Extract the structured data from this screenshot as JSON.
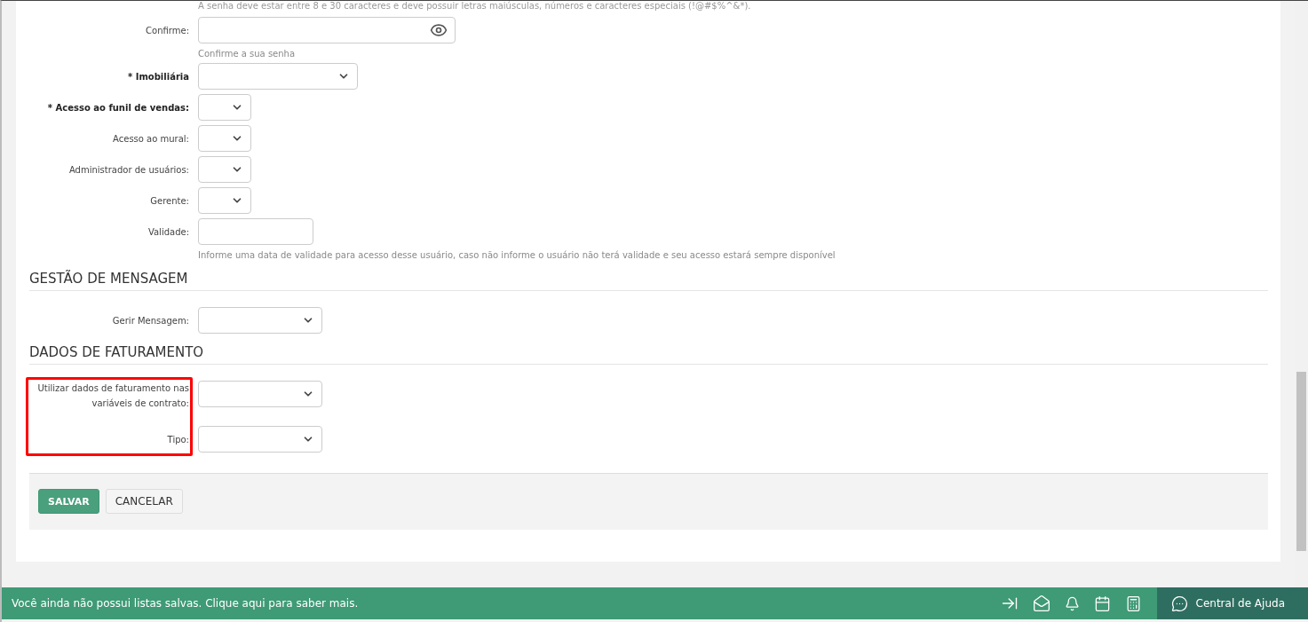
{
  "password_hint": "A senha deve estar entre 8 e 30 caracteres e deve possuir letras maiúsculas, números e caracteres especiais (!@#$%^&*).",
  "fields": [
    {
      "kind": "password",
      "label": "Confirme:",
      "required": false,
      "helper": "Confirme a sua senha"
    },
    {
      "kind": "dropdown",
      "label": "* Imobiliária",
      "required": true
    },
    {
      "kind": "toggle",
      "label": "* Acesso ao funil de vendas:",
      "required": true
    },
    {
      "kind": "toggle",
      "label": "Acesso ao mural:",
      "required": false
    },
    {
      "kind": "toggle",
      "label": "Administrador de usuários:",
      "required": false
    },
    {
      "kind": "toggle",
      "label": "Gerente:",
      "required": false
    },
    {
      "kind": "date",
      "label": "Validade:",
      "required": false,
      "helper": "Informe uma data de validade para acesso desse usuário, caso não informe o usuário não terá validade e seu acesso estará sempre disponível"
    }
  ],
  "sections": [
    {
      "title": "GESTÃO DE MENSAGEM",
      "highlighted": false,
      "fields": [
        {
          "kind": "select",
          "label": "Gerir Mensagem:",
          "required": false
        }
      ]
    },
    {
      "title": "DADOS DE FATURAMENTO",
      "highlighted": true,
      "fields": [
        {
          "kind": "select",
          "label": "Utilizar dados de faturamento nas variáveis de contrato:",
          "required": false
        },
        {
          "kind": "select",
          "label": "Tipo:",
          "required": false
        }
      ]
    }
  ],
  "buttons": [
    {
      "label": "SALVAR",
      "kind": "primary"
    },
    {
      "label": "CANCELAR",
      "kind": "secondary"
    }
  ],
  "status_bar": {
    "message": "Você ainda não possui listas salvas. Clique aqui para saber mais.",
    "help_label": "Central de Ajuda"
  }
}
